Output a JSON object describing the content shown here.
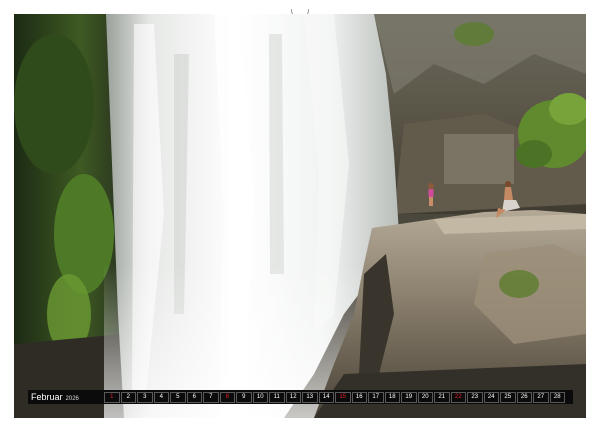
{
  "calendar": {
    "month": "Februar",
    "year": "2026",
    "days": [
      {
        "n": "1",
        "sunday": true
      },
      {
        "n": "2",
        "sunday": false
      },
      {
        "n": "3",
        "sunday": false
      },
      {
        "n": "4",
        "sunday": false
      },
      {
        "n": "5",
        "sunday": false
      },
      {
        "n": "6",
        "sunday": false
      },
      {
        "n": "7",
        "sunday": false
      },
      {
        "n": "8",
        "sunday": true
      },
      {
        "n": "9",
        "sunday": false
      },
      {
        "n": "10",
        "sunday": false
      },
      {
        "n": "11",
        "sunday": false
      },
      {
        "n": "12",
        "sunday": false
      },
      {
        "n": "13",
        "sunday": false
      },
      {
        "n": "14",
        "sunday": false
      },
      {
        "n": "15",
        "sunday": true
      },
      {
        "n": "16",
        "sunday": false
      },
      {
        "n": "17",
        "sunday": false
      },
      {
        "n": "18",
        "sunday": false
      },
      {
        "n": "19",
        "sunday": false
      },
      {
        "n": "20",
        "sunday": false
      },
      {
        "n": "21",
        "sunday": false
      },
      {
        "n": "22",
        "sunday": true
      },
      {
        "n": "23",
        "sunday": false
      },
      {
        "n": "24",
        "sunday": false
      },
      {
        "n": "25",
        "sunday": false
      },
      {
        "n": "26",
        "sunday": false
      },
      {
        "n": "27",
        "sunday": false
      },
      {
        "n": "28",
        "sunday": false
      }
    ],
    "colors": {
      "bar": "#0b0b0b",
      "weekday": "#ffffff",
      "sunday": "#e0202a"
    }
  },
  "photo": {
    "subject": "waterfall-with-two-people-on-rocks"
  }
}
